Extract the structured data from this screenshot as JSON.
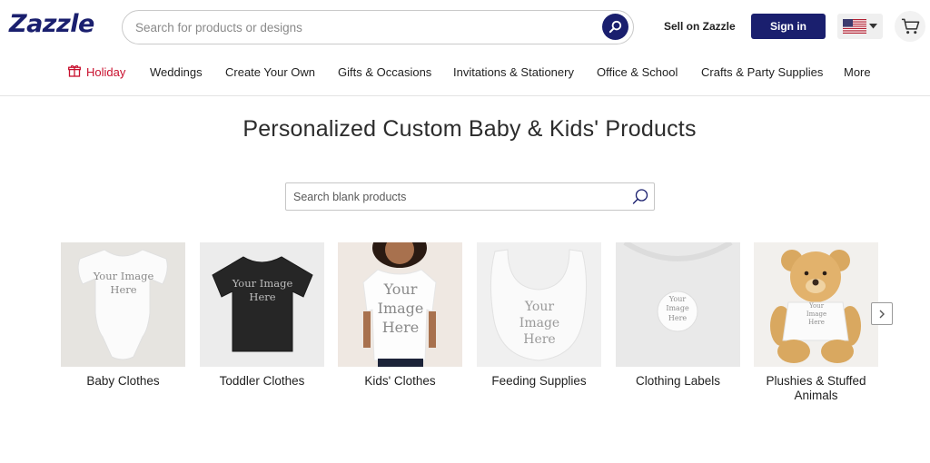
{
  "brand": {
    "logo_text": "Zazzle",
    "accent": "#1a1f6e",
    "holiday_color": "#c8102e"
  },
  "header": {
    "search_placeholder": "Search for products or designs",
    "search_icon": "search-icon",
    "sell_label": "Sell on Zazzle",
    "signin_label": "Sign in",
    "country_icon": "us-flag-icon",
    "cart_icon": "cart-icon"
  },
  "nav": {
    "items": [
      {
        "label": "Holiday",
        "icon": "gift-icon"
      },
      {
        "label": "Weddings"
      },
      {
        "label": "Create Your Own"
      },
      {
        "label": "Gifts & Occasions"
      },
      {
        "label": "Invitations & Stationery"
      },
      {
        "label": "Office & School"
      },
      {
        "label": "Crafts & Party Supplies"
      },
      {
        "label": "More"
      }
    ]
  },
  "main": {
    "title": "Personalized Custom Baby & Kids' Products",
    "search_placeholder": "Search blank products",
    "categories": [
      {
        "label": "Baby Clothes",
        "image_text": "Your Image Here"
      },
      {
        "label": "Toddler Clothes",
        "image_text": "Your Image Here"
      },
      {
        "label": "Kids' Clothes",
        "image_text": "Your Image Here"
      },
      {
        "label": "Feeding Supplies",
        "image_text": "Your Image Here"
      },
      {
        "label": "Clothing Labels",
        "image_text": "Your Image Here"
      },
      {
        "label": "Plushies & Stuffed Animals",
        "image_text": "Your Image Here"
      }
    ],
    "next_icon": "chevron-right-icon"
  }
}
